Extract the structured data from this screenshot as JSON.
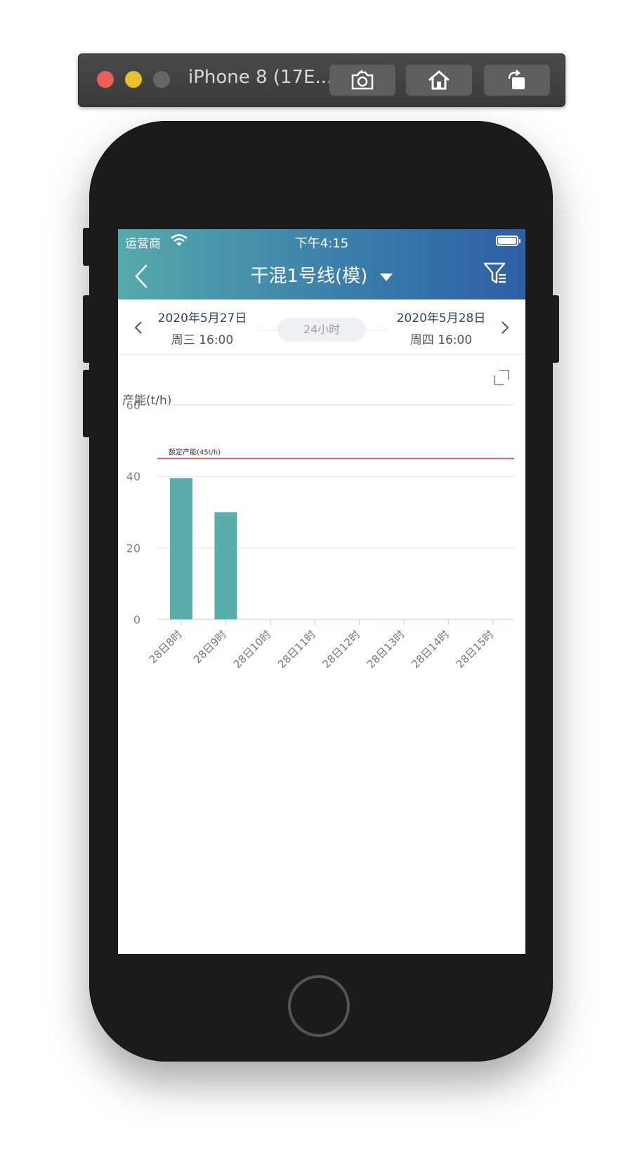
{
  "simulator": {
    "title": "iPhone 8 (17E..."
  },
  "status_bar": {
    "carrier": "运营商",
    "time": "下午4:15"
  },
  "nav": {
    "title": "干混1号线(模)"
  },
  "date_bar": {
    "start_date": "2020年5月27日",
    "start_sub": "周三  16:00",
    "range": "24小时",
    "end_date": "2020年5月28日",
    "end_sub": "周四  16:00"
  },
  "colors": {
    "header_start": "#55a9ab",
    "header_end": "#2e5ea6",
    "bar": "#59aeac",
    "rated_line": "#e0463e"
  },
  "chart_data": {
    "type": "bar",
    "ylabel": "产能(t/h)",
    "ylim": [
      0,
      60
    ],
    "yticks": [
      0,
      20,
      40,
      60
    ],
    "categories": [
      "28日8时",
      "28日9时",
      "28日10时",
      "28日11时",
      "28日12时",
      "28日13时",
      "28日14时",
      "28日15时"
    ],
    "values": [
      39.5,
      30,
      null,
      null,
      null,
      null,
      null,
      null
    ],
    "reference_line": {
      "value": 45,
      "label": "额定产能(45t/h)"
    },
    "grid": true
  }
}
